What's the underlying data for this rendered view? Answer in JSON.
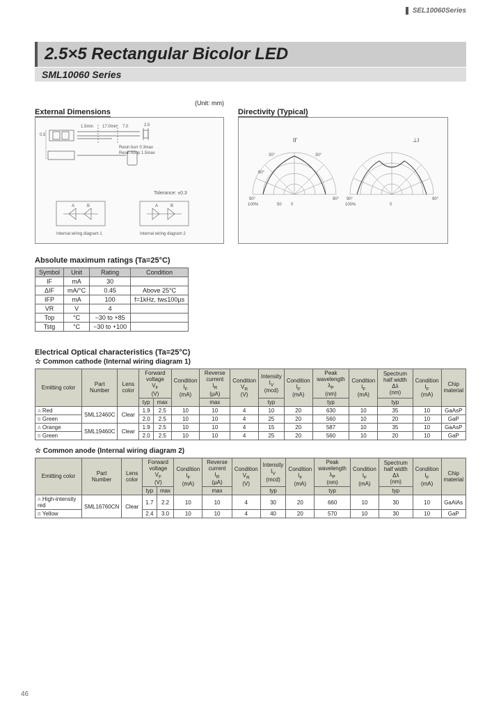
{
  "header": "SEL10060Series",
  "title_main": "2.5×5 Rectangular Bicolor LED",
  "title_sub": "SML10060 Series",
  "ext_dim_heading": "External Dimensions",
  "ext_dim_unit": "(Unit: mm)",
  "directivity_heading": "Directivity (Typical)",
  "ext_dim_labels": {
    "tolerance": "Tolerance: ±0.3",
    "resin_burr": "Resin burr 0.3max",
    "resin_hoop": "Resin hoop 1.5max",
    "wiring1": "Internal wiring diagram 1",
    "wiring2": "Internal wiring diagram 2"
  },
  "abs_max_heading": "Absolute maximum ratings (Ta=25°C)",
  "abs_max_headers": [
    "Symbol",
    "Unit",
    "Rating",
    "Condition"
  ],
  "abs_max_rows": [
    {
      "symbol": "IF",
      "unit": "mA",
      "rating": "30",
      "condition": ""
    },
    {
      "symbol": "ΔIF",
      "unit": "mA/°C",
      "rating": "0.45",
      "condition": "Above 25°C"
    },
    {
      "symbol": "IFP",
      "unit": "mA",
      "rating": "100",
      "condition": "f=1kHz, tw≤100µs"
    },
    {
      "symbol": "VR",
      "unit": "V",
      "rating": "4",
      "condition": ""
    },
    {
      "symbol": "Top",
      "unit": "°C",
      "rating": "−30 to +85",
      "condition": ""
    },
    {
      "symbol": "Tstg",
      "unit": "°C",
      "rating": "−30 to +100",
      "condition": ""
    }
  ],
  "eo_heading": "Electrical Optical characteristics (Ta=25°C)",
  "cc_heading": "☆ Common cathode (Internal wiring diagram 1)",
  "ca_heading": "☆ Common anode (Internal wiring diagram 2)",
  "char_headers_top": [
    "Emitting color",
    "Part Number",
    "Lens color",
    "Forward voltage VF (V)",
    "Condition IF (mA)",
    "Reverse current IR (µA)",
    "Condition VR (V)",
    "Intensity Iv (mcd)",
    "Condition IF (mA)",
    "Peak wavelength λP (nm)",
    "Condition IF (mA)",
    "Spectrum half width Δλ (nm)",
    "Condition IF (mA)",
    "Chip material"
  ],
  "sub_vf": {
    "typ": "typ",
    "max": "max"
  },
  "sub_ir": {
    "max": "max"
  },
  "sub_iv": {
    "typ": "typ"
  },
  "sub_lp": {
    "typ": "typ"
  },
  "sub_dl": {
    "typ": "typ"
  },
  "cc_rows": [
    {
      "lbl": "A",
      "color": "Red",
      "part": "SML12460C",
      "lens": "Clear",
      "vf_typ": "1.9",
      "vf_max": "2.5",
      "if": "10",
      "ir": "10",
      "vr": "4",
      "iv": "10",
      "ifc": "20",
      "lp": "630",
      "ifc2": "10",
      "dl": "35",
      "ifc3": "10",
      "chip": "GaAsP"
    },
    {
      "lbl": "B",
      "color": "Green",
      "part": "",
      "lens": "",
      "vf_typ": "2.0",
      "vf_max": "2.5",
      "if": "10",
      "ir": "10",
      "vr": "4",
      "iv": "25",
      "ifc": "20",
      "lp": "560",
      "ifc2": "10",
      "dl": "20",
      "ifc3": "10",
      "chip": "GaP"
    },
    {
      "lbl": "A",
      "color": "Orange",
      "part": "SML19460C",
      "lens": "Clear",
      "vf_typ": "1.9",
      "vf_max": "2.5",
      "if": "10",
      "ir": "10",
      "vr": "4",
      "iv": "15",
      "ifc": "20",
      "lp": "587",
      "ifc2": "10",
      "dl": "35",
      "ifc3": "10",
      "chip": "GaAsP"
    },
    {
      "lbl": "B",
      "color": "Green",
      "part": "",
      "lens": "",
      "vf_typ": "2.0",
      "vf_max": "2.5",
      "if": "10",
      "ir": "10",
      "vr": "4",
      "iv": "25",
      "ifc": "20",
      "lp": "560",
      "ifc2": "10",
      "dl": "20",
      "ifc3": "10",
      "chip": "GaP"
    }
  ],
  "ca_rows": [
    {
      "lbl": "A",
      "color": "High-intensity red",
      "part": "SML16760CN",
      "lens": "Clear",
      "vf_typ": "1.7",
      "vf_max": "2.2",
      "if": "10",
      "ir": "10",
      "vr": "4",
      "iv": "30",
      "ifc": "20",
      "lp": "660",
      "ifc2": "10",
      "dl": "30",
      "ifc3": "10",
      "chip": "GaAlAs"
    },
    {
      "lbl": "B",
      "color": "Yellow",
      "part": "",
      "lens": "",
      "vf_typ": "2.4",
      "vf_max": "3.0",
      "if": "10",
      "ir": "10",
      "vr": "4",
      "iv": "40",
      "ifc": "20",
      "lp": "570",
      "ifc2": "10",
      "dl": "30",
      "ifc3": "10",
      "chip": "GaP"
    }
  ],
  "page_number": "46"
}
